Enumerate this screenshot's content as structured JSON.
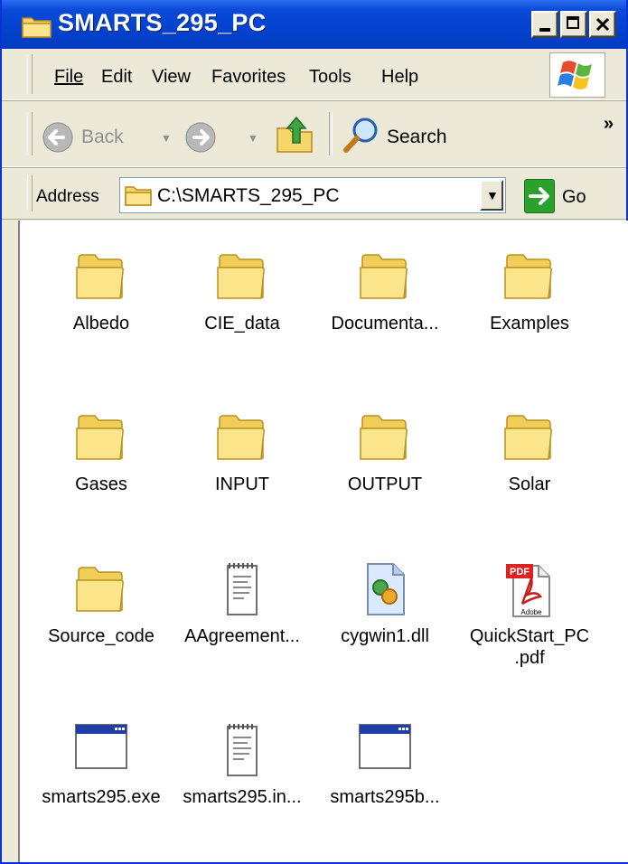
{
  "window": {
    "title": "SMARTS_295_PC"
  },
  "menubar": {
    "items": [
      {
        "key": "file",
        "label": "File"
      },
      {
        "key": "edit",
        "label": "Edit"
      },
      {
        "key": "view",
        "label": "View"
      },
      {
        "key": "favorites",
        "label": "Favorites"
      },
      {
        "key": "tools",
        "label": "Tools"
      },
      {
        "key": "help",
        "label": "Help"
      }
    ]
  },
  "toolbar": {
    "back_label": "Back",
    "search_label": "Search",
    "overflow": "»"
  },
  "address": {
    "label": "Address",
    "value": "C:\\SMARTS_295_PC",
    "go_label": "Go"
  },
  "files": [
    {
      "label": "Albedo",
      "icon": "folder-icon"
    },
    {
      "label": "CIE_data",
      "icon": "folder-icon"
    },
    {
      "label": "Documenta...",
      "icon": "folder-icon"
    },
    {
      "label": "Examples",
      "icon": "folder-icon"
    },
    {
      "label": "Gases",
      "icon": "folder-icon"
    },
    {
      "label": "INPUT",
      "icon": "folder-icon"
    },
    {
      "label": "OUTPUT",
      "icon": "folder-icon"
    },
    {
      "label": "Solar",
      "icon": "folder-icon"
    },
    {
      "label": "Source_code",
      "icon": "folder-icon"
    },
    {
      "label": "AAgreement...",
      "icon": "text-file-icon"
    },
    {
      "label": "cygwin1.dll",
      "icon": "dll-file-icon"
    },
    {
      "label": "QuickStart_PC",
      "label2": ".pdf",
      "icon": "pdf-file-icon",
      "badge": "PDF",
      "brand": "Adobe"
    },
    {
      "label": "smarts295.exe",
      "icon": "exe-file-icon"
    },
    {
      "label": "smarts295.in...",
      "icon": "text-file-icon"
    },
    {
      "label": "smarts295b...",
      "icon": "exe-file-icon"
    }
  ]
}
